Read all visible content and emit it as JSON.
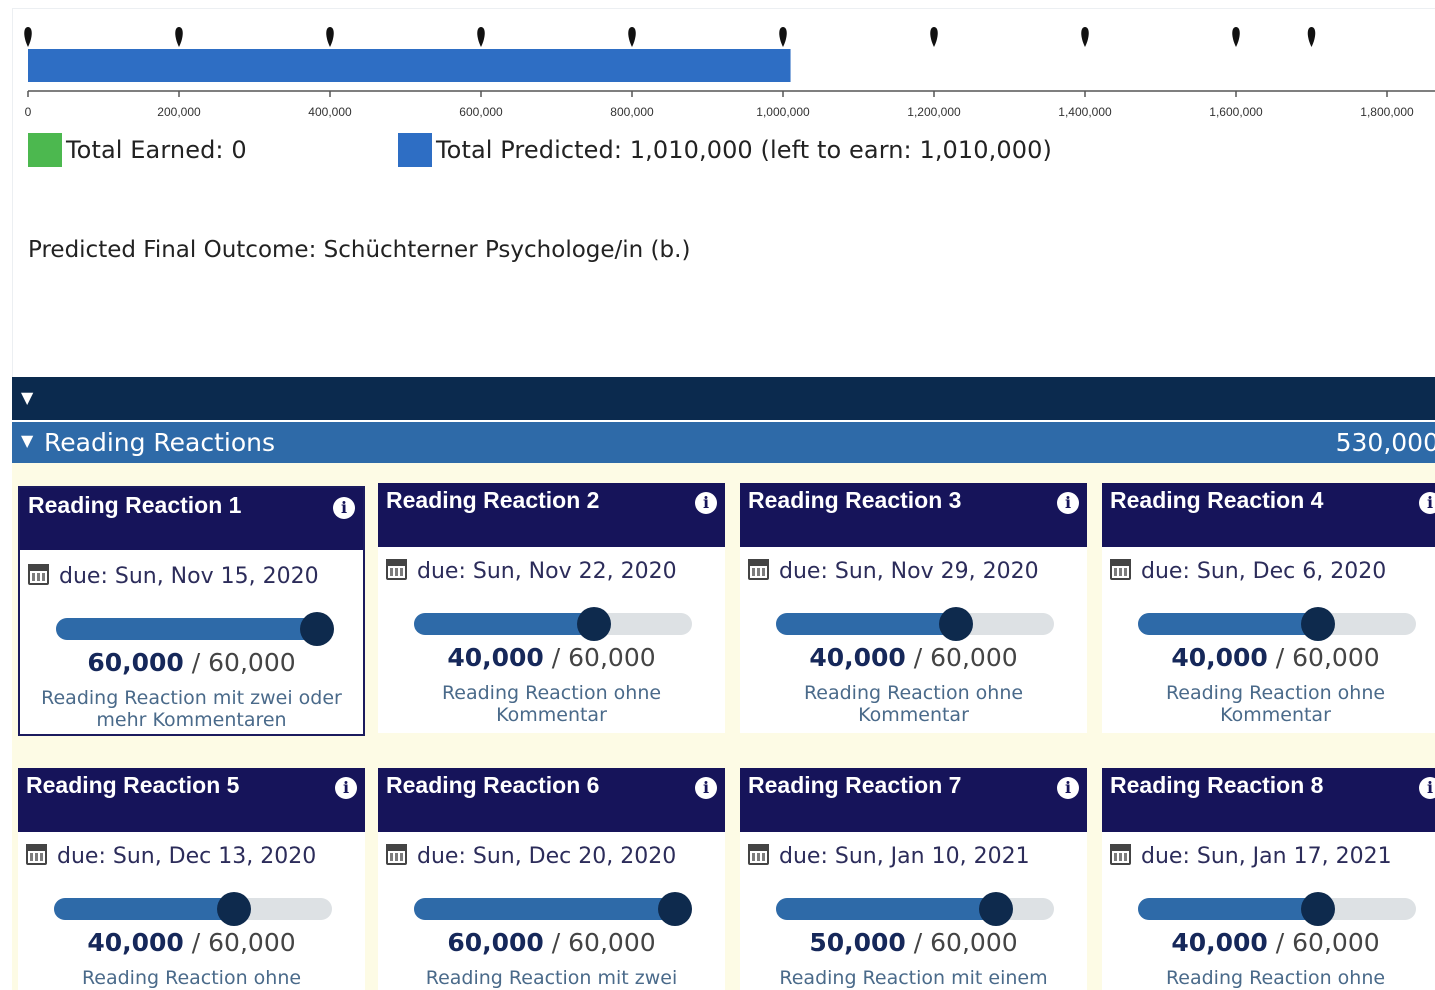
{
  "progress": {
    "axis_ticks": [
      "0",
      "200,000",
      "400,000",
      "600,000",
      "800,000",
      "1,000,000",
      "1,200,000",
      "1,400,000",
      "1,600,000",
      "1,800,000"
    ],
    "axis_max": 2000000,
    "milestone_values": [
      0,
      200000,
      400000,
      600000,
      800000,
      1000000,
      1200000,
      1400000,
      1600000,
      1700000
    ],
    "earned_value": 0,
    "predicted_value": 1010000,
    "colors": {
      "earned": "#4cb84f",
      "predicted": "#2e6ec4",
      "marker": "#111111"
    }
  },
  "legend": {
    "earned_label": "Total Earned: 0",
    "predicted_label": "Total Predicted: 1,010,000 (left to earn: 1,010,000)"
  },
  "outcome_text": "Predicted Final Outcome: Schüchterner Psychologe/in (b.)",
  "section": {
    "title": "Reading Reactions",
    "total": "530,000"
  },
  "cards": [
    {
      "title": "Reading Reaction 1",
      "due": "due: Sun, Nov 15, 2020",
      "earned": "60,000",
      "max": "60,000",
      "fraction": 1.0,
      "desc": "Reading Reaction mit zwei oder mehr Kommentaren",
      "selected": true
    },
    {
      "title": "Reading Reaction 2",
      "due": "due: Sun, Nov 22, 2020",
      "earned": "40,000",
      "max": "60,000",
      "fraction": 0.667,
      "desc": "Reading Reaction ohne Kommentar"
    },
    {
      "title": "Reading Reaction 3",
      "due": "due: Sun, Nov 29, 2020",
      "earned": "40,000",
      "max": "60,000",
      "fraction": 0.667,
      "desc": "Reading Reaction ohne Kommentar"
    },
    {
      "title": "Reading Reaction 4",
      "due": "due: Sun, Dec 6, 2020",
      "earned": "40,000",
      "max": "60,000",
      "fraction": 0.667,
      "desc": "Reading Reaction ohne Kommentar"
    },
    {
      "title": "Reading Reaction 5",
      "due": "due: Sun, Dec 13, 2020",
      "earned": "40,000",
      "max": "60,000",
      "fraction": 0.667,
      "desc": "Reading Reaction ohne"
    },
    {
      "title": "Reading Reaction 6",
      "due": "due: Sun, Dec 20, 2020",
      "earned": "60,000",
      "max": "60,000",
      "fraction": 1.0,
      "desc": "Reading Reaction mit zwei"
    },
    {
      "title": "Reading Reaction 7",
      "due": "due: Sun, Jan 10, 2021",
      "earned": "50,000",
      "max": "60,000",
      "fraction": 0.833,
      "desc": "Reading Reaction mit einem"
    },
    {
      "title": "Reading Reaction 8",
      "due": "due: Sun, Jan 17, 2021",
      "earned": "40,000",
      "max": "60,000",
      "fraction": 0.667,
      "desc": "Reading Reaction ohne"
    }
  ],
  "points_separator": "/",
  "icons": {
    "info": "info-icon",
    "calendar": "calendar-icon",
    "collapse": "triangle-down-icon"
  },
  "colors": {
    "dark_navy": "#0b2a4e",
    "section_blue": "#2e6aa8",
    "card_header": "#16145a",
    "cards_bg": "#fdfbe5"
  }
}
